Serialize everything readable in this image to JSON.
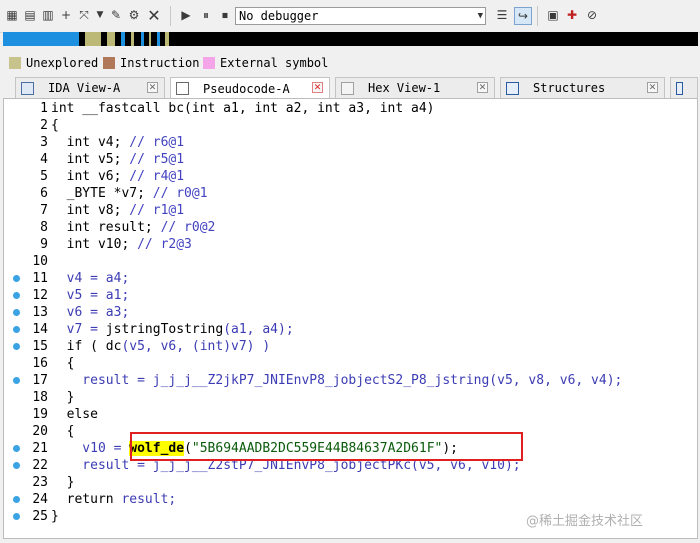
{
  "debugger": {
    "selected": "No debugger"
  },
  "legend": [
    {
      "label": "Unexplored",
      "color": "#c8c28c"
    },
    {
      "label": "Instruction",
      "color": "#b07858"
    },
    {
      "label": "External symbol",
      "color": "#f4a4e8"
    }
  ],
  "navband_colors": {
    "blue": "#1e90e0",
    "olive": "#bcb876",
    "dark": "#000000"
  },
  "tabs": [
    {
      "label": "IDA View-A",
      "icon": "ida-view-icon"
    },
    {
      "label": "Pseudocode-A",
      "icon": "pseudocode-icon"
    },
    {
      "label": "Hex View-1",
      "icon": "hex-view-icon"
    },
    {
      "label": "Structures",
      "icon": "structures-icon"
    }
  ],
  "code": [
    {
      "n": "1",
      "bp": false,
      "tokens": [
        {
          "t": "int __fastcall bc(int a1, int a2, int a3, int a4)",
          "c": "kw"
        }
      ]
    },
    {
      "n": "2",
      "bp": false,
      "tokens": [
        {
          "t": "{",
          "c": "kw"
        }
      ]
    },
    {
      "n": "3",
      "bp": false,
      "tokens": [
        {
          "t": "  int v4; ",
          "c": "kw"
        },
        {
          "t": "// r6@1",
          "c": "cm"
        }
      ]
    },
    {
      "n": "4",
      "bp": false,
      "tokens": [
        {
          "t": "  int v5; ",
          "c": "kw"
        },
        {
          "t": "// r5@1",
          "c": "cm"
        }
      ]
    },
    {
      "n": "5",
      "bp": false,
      "tokens": [
        {
          "t": "  int v6; ",
          "c": "kw"
        },
        {
          "t": "// r4@1",
          "c": "cm"
        }
      ]
    },
    {
      "n": "6",
      "bp": false,
      "tokens": [
        {
          "t": "  _BYTE *v7; ",
          "c": "kw"
        },
        {
          "t": "// r0@1",
          "c": "cm"
        }
      ]
    },
    {
      "n": "7",
      "bp": false,
      "tokens": [
        {
          "t": "  int v8; ",
          "c": "kw"
        },
        {
          "t": "// r1@1",
          "c": "cm"
        }
      ]
    },
    {
      "n": "8",
      "bp": false,
      "tokens": [
        {
          "t": "  int result; ",
          "c": "kw"
        },
        {
          "t": "// r0@2",
          "c": "cm"
        }
      ]
    },
    {
      "n": "9",
      "bp": false,
      "tokens": [
        {
          "t": "  int v10; ",
          "c": "kw"
        },
        {
          "t": "// r2@3",
          "c": "cm"
        }
      ]
    },
    {
      "n": "10",
      "bp": false,
      "tokens": [
        {
          "t": "",
          "c": "kw"
        }
      ]
    },
    {
      "n": "11",
      "bp": true,
      "tokens": [
        {
          "t": "  v4 = a4;",
          "c": "var"
        }
      ]
    },
    {
      "n": "12",
      "bp": true,
      "tokens": [
        {
          "t": "  v5 = a1;",
          "c": "var"
        }
      ]
    },
    {
      "n": "13",
      "bp": true,
      "tokens": [
        {
          "t": "  v6 = a3;",
          "c": "var"
        }
      ]
    },
    {
      "n": "14",
      "bp": true,
      "tokens": [
        {
          "t": "  v7 = ",
          "c": "var"
        },
        {
          "t": "jstringTostring",
          "c": "kw"
        },
        {
          "t": "(a1, a4);",
          "c": "var"
        }
      ]
    },
    {
      "n": "15",
      "bp": true,
      "tokens": [
        {
          "t": "  if ( ",
          "c": "kw"
        },
        {
          "t": "dc",
          "c": "kw"
        },
        {
          "t": "(v5, v6, (int)v7) )",
          "c": "var"
        }
      ]
    },
    {
      "n": "16",
      "bp": false,
      "tokens": [
        {
          "t": "  {",
          "c": "kw"
        }
      ]
    },
    {
      "n": "17",
      "bp": true,
      "tokens": [
        {
          "t": "    result = ",
          "c": "var"
        },
        {
          "t": "j_j_j__Z2jkP7_JNIEnvP8_jobjectS2_P8_jstring",
          "c": "var"
        },
        {
          "t": "(v5, v8, v6, v4);",
          "c": "var"
        }
      ]
    },
    {
      "n": "18",
      "bp": false,
      "tokens": [
        {
          "t": "  }",
          "c": "kw"
        }
      ]
    },
    {
      "n": "19",
      "bp": false,
      "tokens": [
        {
          "t": "  else",
          "c": "kw"
        }
      ]
    },
    {
      "n": "20",
      "bp": false,
      "tokens": [
        {
          "t": "  {",
          "c": "kw"
        }
      ]
    },
    {
      "n": "21",
      "bp": true,
      "tokens": [
        {
          "t": "    v10 = ",
          "c": "var"
        },
        {
          "t": "wolf_de",
          "c": "hl"
        },
        {
          "t": "(",
          "c": "kw"
        },
        {
          "t": "\"5B694AADB2DC559E44B84637A2D61F\"",
          "c": "str"
        },
        {
          "t": ");",
          "c": "kw"
        }
      ]
    },
    {
      "n": "22",
      "bp": true,
      "tokens": [
        {
          "t": "    result = ",
          "c": "var"
        },
        {
          "t": "j_j_j__Z2stP7_JNIEnvP8_jobjectPKc",
          "c": "var"
        },
        {
          "t": "(v5, v6, v10);",
          "c": "var"
        }
      ]
    },
    {
      "n": "23",
      "bp": false,
      "tokens": [
        {
          "t": "  }",
          "c": "kw"
        }
      ]
    },
    {
      "n": "24",
      "bp": true,
      "tokens": [
        {
          "t": "  return ",
          "c": "kw"
        },
        {
          "t": "result;",
          "c": "var"
        }
      ]
    },
    {
      "n": "25",
      "bp": true,
      "tokens": [
        {
          "t": "}",
          "c": "kw"
        }
      ]
    }
  ],
  "watermark": "@稀土掘金技术社区"
}
